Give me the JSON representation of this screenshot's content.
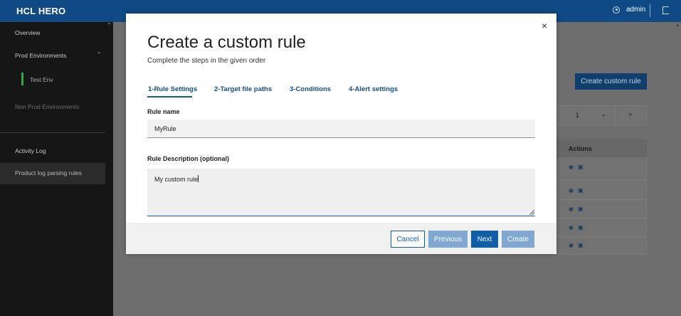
{
  "app": {
    "title": "HCL HERO"
  },
  "header": {
    "user_icon": "user-circle-icon",
    "username": "admin",
    "logout_icon": "logout-icon"
  },
  "sidebar": {
    "items": [
      {
        "label": "Overview"
      },
      {
        "label": "Prod Environments"
      },
      {
        "label": "Test Env"
      },
      {
        "label": "Non Prod Environments"
      },
      {
        "label": "Activity Log"
      },
      {
        "label": "Product log parsing rules"
      }
    ]
  },
  "background": {
    "create_button": "Create custom rule",
    "pager": {
      "page": "1",
      "next": ">"
    },
    "table": {
      "actions_header": "Actions",
      "row_icons": [
        "view-icon",
        "copy-icon"
      ]
    }
  },
  "modal": {
    "close_label": "×",
    "title": "Create a custom rule",
    "subtitle": "Complete the steps in the given order",
    "tabs": [
      {
        "label": "1-Rule Settings",
        "active": true
      },
      {
        "label": "2-Target file paths",
        "active": false
      },
      {
        "label": "3-Conditions",
        "active": false
      },
      {
        "label": "4-Alert settings",
        "active": false
      }
    ],
    "rule_name": {
      "label": "Rule name",
      "value": "MyRule"
    },
    "rule_description": {
      "label": "Rule Description (optional)",
      "value": "My custom rule"
    },
    "buttons": {
      "cancel": "Cancel",
      "previous": "Previous",
      "next": "Next",
      "create": "Create"
    }
  },
  "colors": {
    "topbar": "#0f4a86",
    "accent": "#0f5ea8",
    "active_env": "#2fa84f",
    "sidebar": "#161616"
  }
}
